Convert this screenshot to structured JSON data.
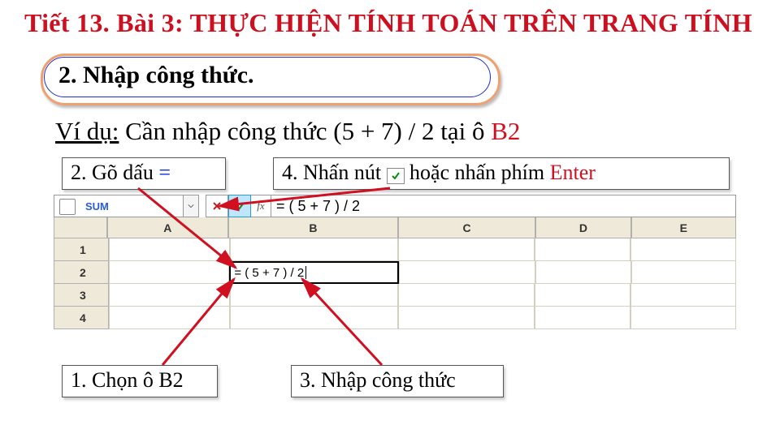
{
  "title_text": "Tiết 13. Bài 3: THỰC HIỆN TÍNH TOÁN TRÊN TRANG TÍNH",
  "section": {
    "heading": "2. Nhập công thức."
  },
  "example": {
    "label": "Ví dụ:",
    "rest": " Cần nhập công thức  (5 + 7) / 2 tại ô ",
    "cellref": "B2"
  },
  "captions": {
    "step1": {
      "num": "1.",
      "text": "  Chọn ô B2"
    },
    "step2": {
      "num": "2.",
      "text": " Gõ dấu ",
      "sym": "="
    },
    "step3": {
      "num": "3.",
      "text": "  Nhập công thức"
    },
    "step4": {
      "num": "4.",
      "text": "  Nhấn nút ",
      "tail_a": "  hoặc nhấn phím ",
      "tail_b": "Enter"
    }
  },
  "excel": {
    "namebox": "SUM",
    "formula_bar": "= ( 5 + 7 ) / 2",
    "columns": [
      "A",
      "B",
      "C",
      "D",
      "E"
    ],
    "rows": [
      "1",
      "2",
      "3",
      "4"
    ],
    "active_cell": {
      "address": "B2",
      "value": "= ( 5 + 7 ) / 2"
    }
  },
  "icons": {
    "cancel": "cancel-icon",
    "enter": "enter-check-icon",
    "fx": "fx-icon",
    "dropdown": "chevron-down-icon"
  }
}
